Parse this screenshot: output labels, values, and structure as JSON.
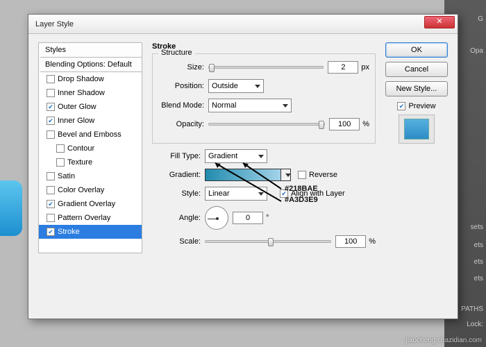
{
  "window": {
    "title": "Layer Style",
    "close": "✕"
  },
  "left": {
    "head_styles": "Styles",
    "head_blend": "Blending Options: Default",
    "items": [
      {
        "label": "Drop Shadow",
        "checked": false
      },
      {
        "label": "Inner Shadow",
        "checked": false
      },
      {
        "label": "Outer Glow",
        "checked": true
      },
      {
        "label": "Inner Glow",
        "checked": true
      },
      {
        "label": "Bevel and Emboss",
        "checked": false
      },
      {
        "label": "Contour",
        "checked": false,
        "indent": true
      },
      {
        "label": "Texture",
        "checked": false,
        "indent": true
      },
      {
        "label": "Satin",
        "checked": false
      },
      {
        "label": "Color Overlay",
        "checked": false
      },
      {
        "label": "Gradient Overlay",
        "checked": true
      },
      {
        "label": "Pattern Overlay",
        "checked": false
      },
      {
        "label": "Stroke",
        "checked": true,
        "selected": true
      }
    ]
  },
  "stroke": {
    "title": "Stroke",
    "structure_legend": "Structure",
    "size_label": "Size:",
    "size_val": "2",
    "size_unit": "px",
    "position_label": "Position:",
    "position_val": "Outside",
    "blend_label": "Blend Mode:",
    "blend_val": "Normal",
    "opacity_label": "Opacity:",
    "opacity_val": "100",
    "opacity_unit": "%",
    "filltype_label": "Fill Type:",
    "filltype_val": "Gradient",
    "gradient_label": "Gradient:",
    "reverse_label": "Reverse",
    "style_label": "Style:",
    "style_val": "Linear",
    "align_label": "Align with Layer",
    "angle_label": "Angle:",
    "angle_val": "0",
    "angle_unit": "°",
    "scale_label": "Scale:",
    "scale_val": "100",
    "scale_unit": "%"
  },
  "right": {
    "ok": "OK",
    "cancel": "Cancel",
    "newstyle": "New Style...",
    "preview": "Preview"
  },
  "annotations": {
    "hex1": "#218BAE",
    "hex2": "#A3D3E9"
  },
  "bg_labels": {
    "o": "Opa",
    "paths": "PATHS",
    "lock": "Lock:",
    "sets": "sets",
    "ets": "ets",
    "g": "G"
  },
  "watermark": "jiaocheng.chazidian.com"
}
